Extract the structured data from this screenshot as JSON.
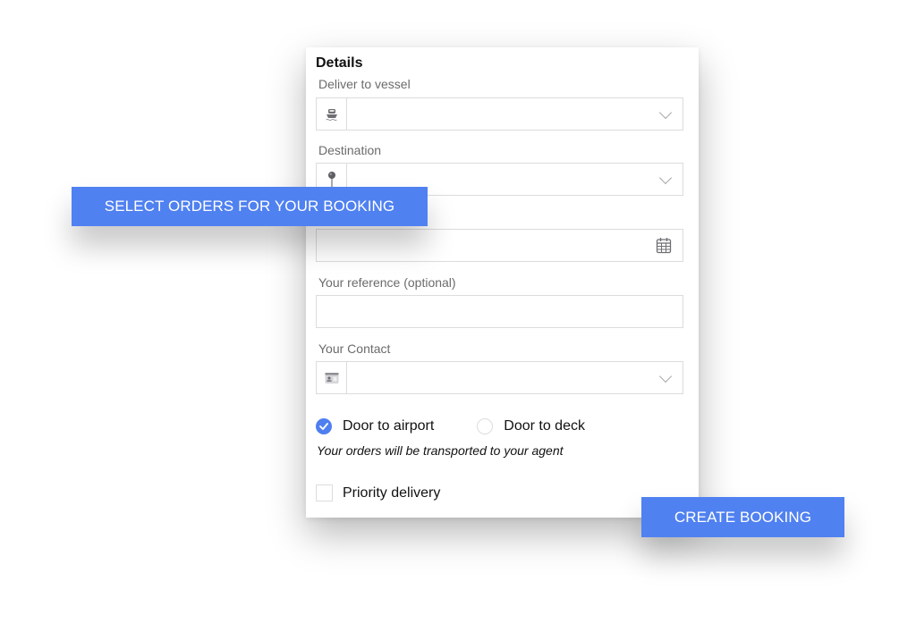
{
  "panel": {
    "title": "Details",
    "fields": {
      "vessel": {
        "label": "Deliver to vessel",
        "value": "",
        "icon": "ship-icon",
        "control": "dropdown"
      },
      "destination": {
        "label": "Destination",
        "value": "",
        "icon": "map-pin-icon",
        "control": "dropdown"
      },
      "date": {
        "label": "",
        "value": "",
        "icon": "calendar-icon",
        "control": "date-picker"
      },
      "reference": {
        "label": "Your reference (optional)",
        "value": "",
        "control": "text-input"
      },
      "contact": {
        "label": "Your Contact",
        "value": "",
        "icon": "contact-card-icon",
        "control": "dropdown"
      }
    },
    "delivery_mode": {
      "options": [
        {
          "label": "Door to airport",
          "selected": true
        },
        {
          "label": "Door to deck",
          "selected": false
        }
      ],
      "hint": "Your orders will be transported to your agent"
    },
    "priority": {
      "label": "Priority delivery",
      "checked": false
    }
  },
  "callouts": {
    "select_orders": "SELECT ORDERS FOR YOUR BOOKING",
    "create_booking": "CREATE BOOKING"
  },
  "colors": {
    "accent": "#5081f0",
    "radio_checked": "#4f7fef",
    "border": "#dcdcdc",
    "label": "#6b6b6b",
    "icon": "#6e6e73"
  }
}
